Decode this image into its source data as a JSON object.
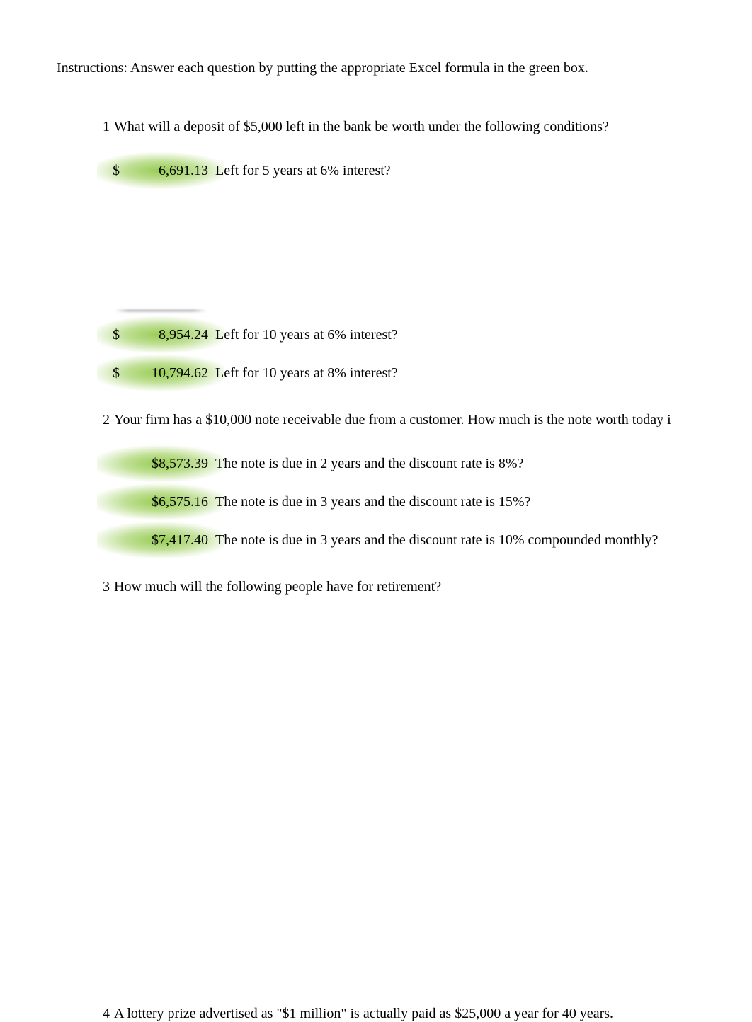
{
  "instructions": "Instructions: Answer each question by putting the appropriate Excel formula in the green box.",
  "q1": {
    "num": "1",
    "text": "What will a deposit of $5,000 left in the bank be worth under the following conditions?",
    "a1": {
      "dollar": "$",
      "amount": "6,691.13",
      "desc": "Left for 5 years at 6% interest?"
    },
    "a2": {
      "dollar": "$",
      "amount": "8,954.24",
      "desc": "Left for 10 years at 6% interest?"
    },
    "a3": {
      "dollar": "$",
      "amount": "10,794.62",
      "desc": "Left for 10 years at 8% interest?"
    }
  },
  "q2": {
    "num": "2",
    "text": "Your firm has a $10,000 note receivable due from a customer. How much is the note worth today i",
    "a1": {
      "amount": "$8,573.39",
      "desc": "The note is due in 2 years and the discount rate is 8%?"
    },
    "a2": {
      "amount": "$6,575.16",
      "desc": "The note is due in 3 years and the discount rate is 15%?"
    },
    "a3": {
      "amount": "$7,417.40",
      "desc": "The note is due in 3 years and the discount rate is 10% compounded monthly?"
    }
  },
  "q3": {
    "num": "3",
    "text": "How much will the following people have for retirement?"
  },
  "q4": {
    "num": "4",
    "text": "A lottery prize advertised as \"$1 million\" is actually paid as $25,000 a year for 40 years."
  }
}
